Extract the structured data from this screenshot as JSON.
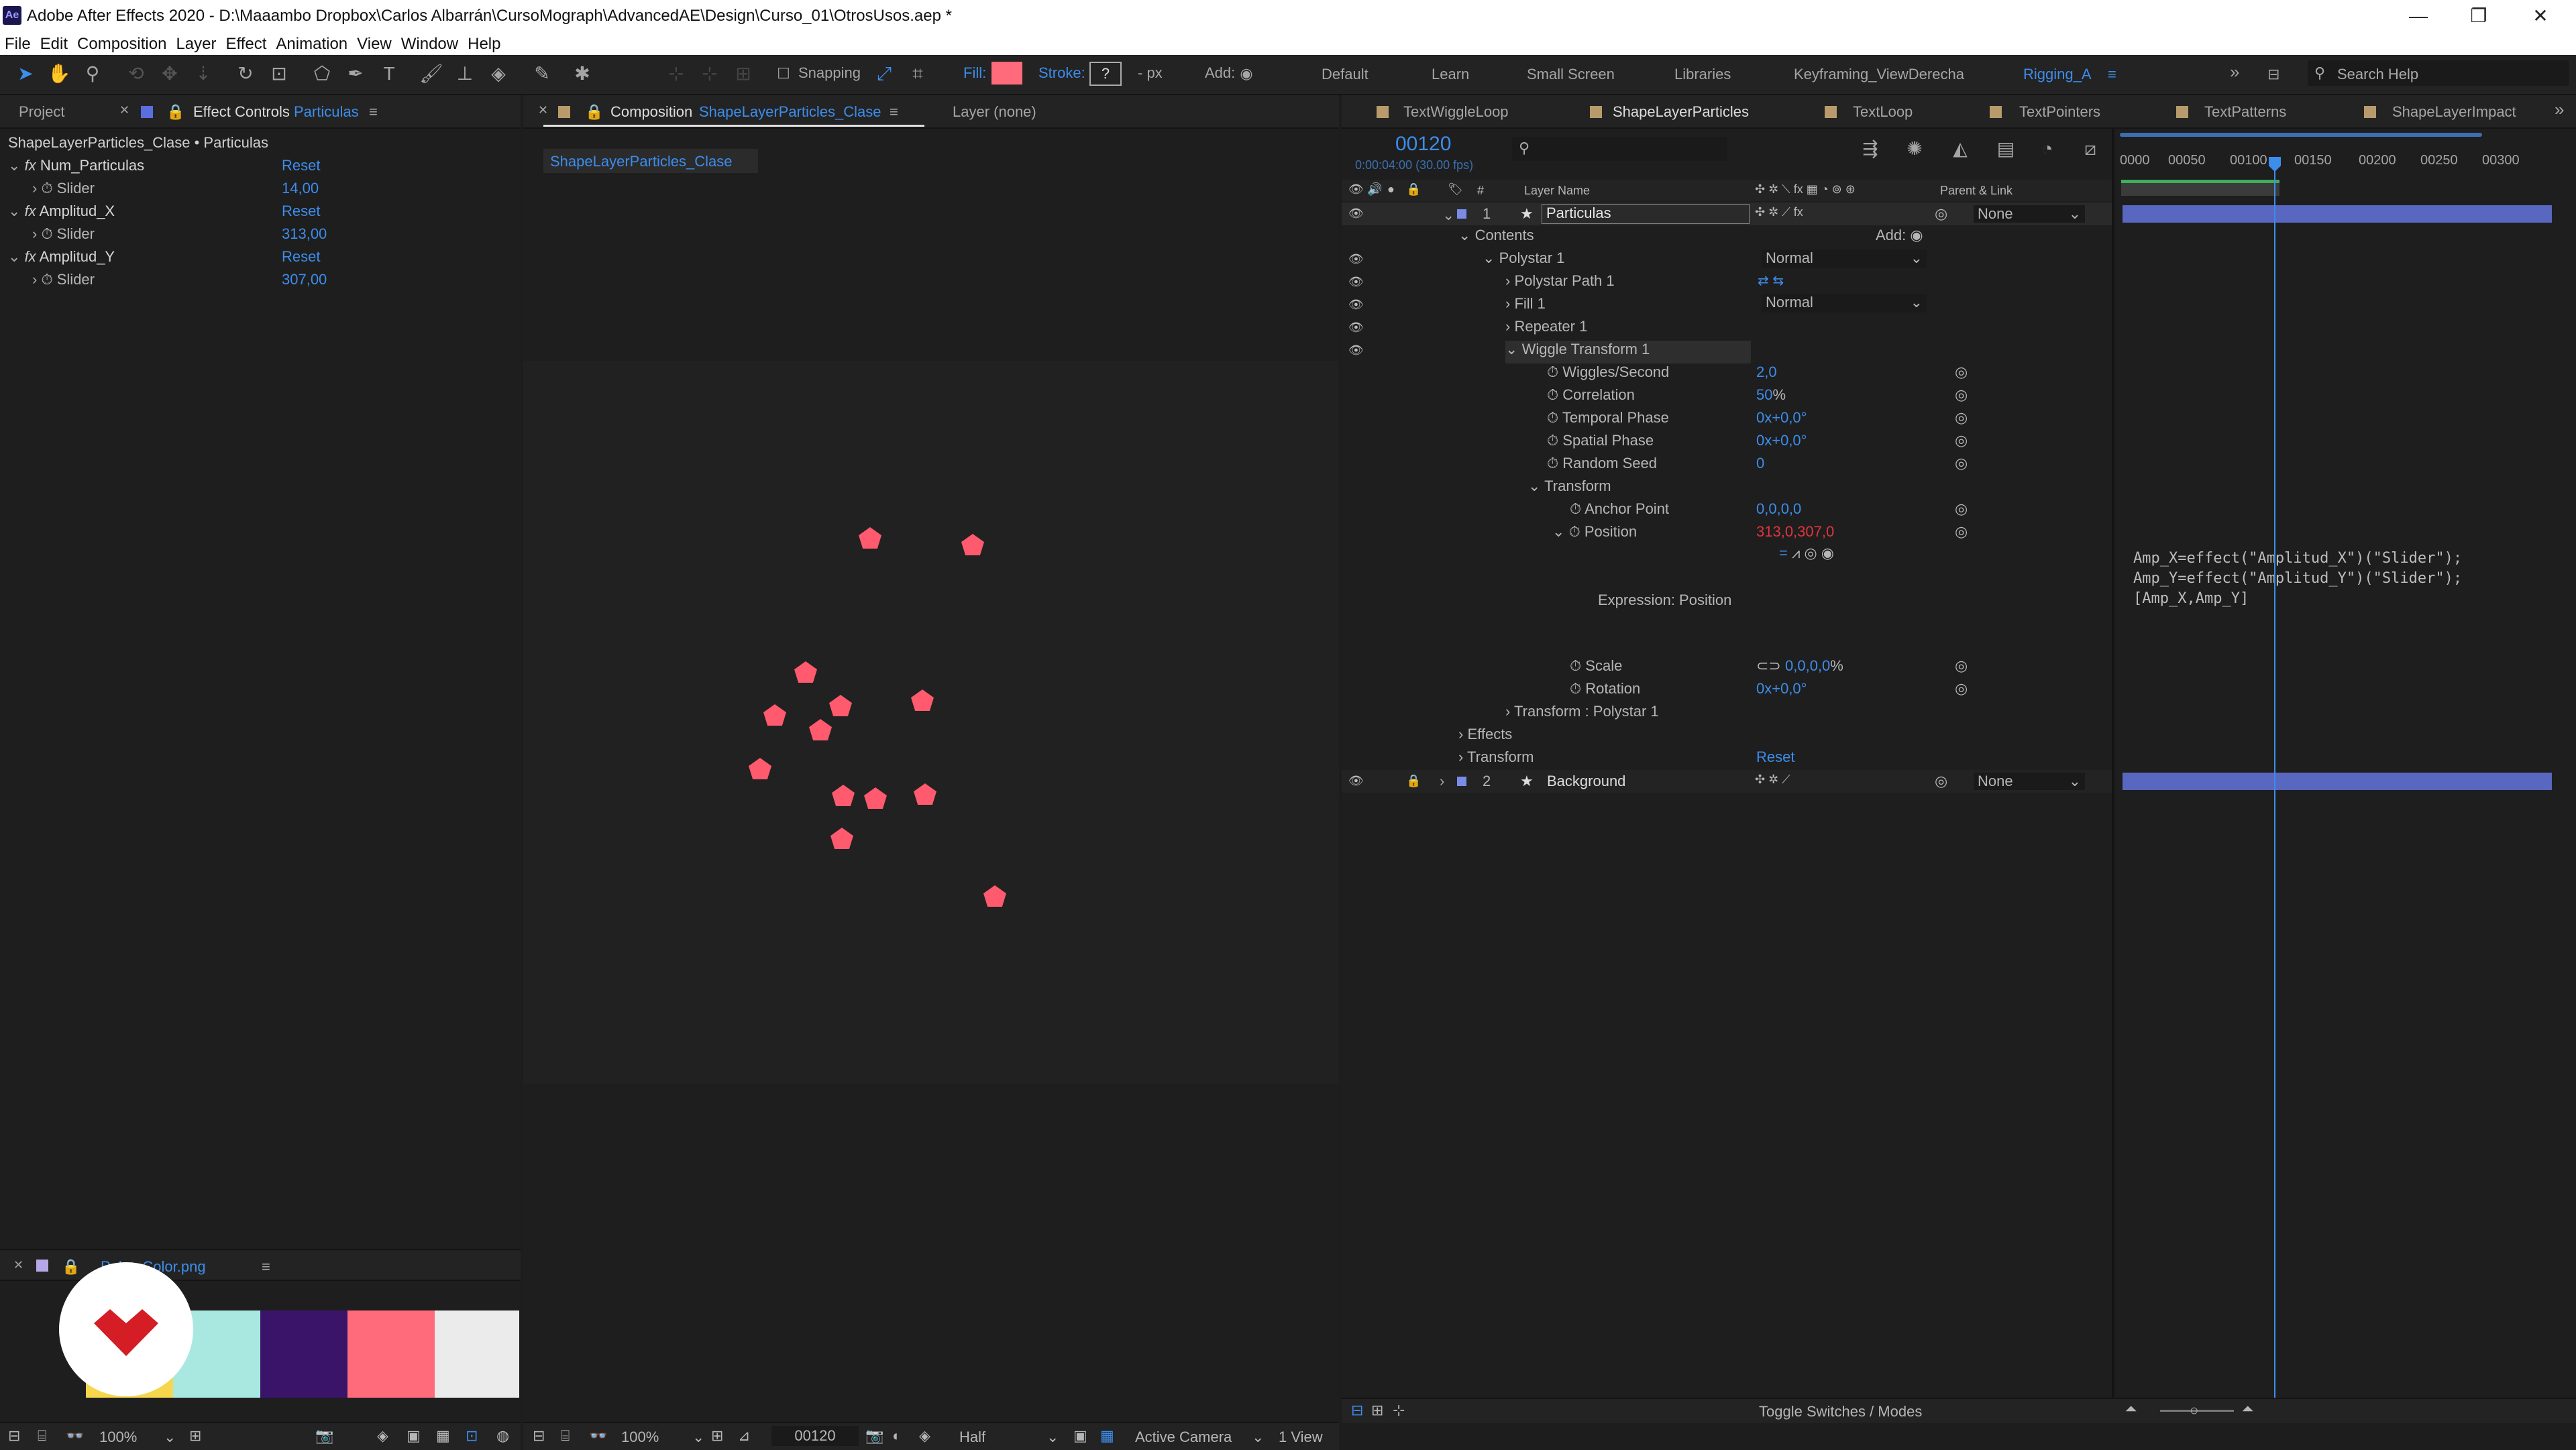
{
  "window": {
    "title": "Adobe After Effects 2020 - D:\\Maaambo Dropbox\\Carlos Albarrán\\CursoMograph\\AdvancedAE\\Design\\Curso_01\\OtrosUsos.aep *",
    "app_icon": "Ae"
  },
  "menu": [
    "File",
    "Edit",
    "Composition",
    "Layer",
    "Effect",
    "Animation",
    "View",
    "Window",
    "Help"
  ],
  "toolbar": {
    "snapping": "Snapping",
    "fill_label": "Fill:",
    "stroke_label": "Stroke:",
    "stroke_value": "?",
    "stroke_unit": "- px",
    "add_label": "Add:",
    "fill_color": "#ff6b7a",
    "workspaces": [
      "Default",
      "Learn",
      "Small Screen",
      "Libraries",
      "Keyframing_ViewDerecha",
      "Rigging_A"
    ],
    "active_workspace": "Rigging_A",
    "search_placeholder": "Search Help"
  },
  "left_panel": {
    "tab_project": "Project",
    "tab_effect": "Effect Controls",
    "tab_effect_layer": "Particulas",
    "header": "ShapeLayerParticles_Clase • Particulas",
    "effects": [
      {
        "name": "Num_Particulas",
        "reset": "Reset",
        "prop": "Slider",
        "value": "14,00"
      },
      {
        "name": "Amplitud_X",
        "reset": "Reset",
        "prop": "Slider",
        "value": "313,00"
      },
      {
        "name": "Amplitud_Y",
        "reset": "Reset",
        "prop": "Slider",
        "value": "307,00"
      }
    ]
  },
  "footage_panel": {
    "title": "PaletaColor.png",
    "swatches": [
      "#f5d64d",
      "#a9e8e0",
      "#3a1469",
      "#ff6b7a",
      "#ebebeb"
    ]
  },
  "comp_panel": {
    "tab_label": "Composition",
    "comp_name": "ShapeLayerParticles_Clase",
    "layer_tab": "Layer  (none)",
    "sub_tab": "ShapeLayerParticles_Clase",
    "zoom": "100%",
    "timecode": "00120",
    "resolution": "Half",
    "camera": "Active Camera",
    "view": "1 View"
  },
  "left_footer": {
    "zoom": "100%"
  },
  "timeline": {
    "tabs": [
      "TextWiggleLoop",
      "ShapeLayerParticles",
      "TextLoop",
      "TextPointers",
      "TextPatterns",
      "ShapeLayerImpact"
    ],
    "timecode": "00120",
    "timecode_sub": "0:00:04:00 (30.00 fps)",
    "col_layer_name": "Layer Name",
    "col_parent": "Parent & Link",
    "ruler": [
      "0000",
      "00050",
      "00100",
      "00150",
      "00200",
      "00250",
      "00300"
    ],
    "layer1": {
      "num": "1",
      "name": "Particulas",
      "parent": "None"
    },
    "layer2": {
      "num": "2",
      "name": "Background",
      "parent": "None"
    },
    "contents": "Contents",
    "add": "Add:",
    "polystar": "Polystar 1",
    "polystar_mode": "Normal",
    "polystar_path": "Polystar Path 1",
    "fill": "Fill 1",
    "fill_mode": "Normal",
    "repeater": "Repeater 1",
    "wiggle": "Wiggle Transform 1",
    "wiggles_label": "Wiggles/Second",
    "wiggles_value": "2,0",
    "correlation_label": "Correlation",
    "correlation_value": "50",
    "correlation_unit": "%",
    "temporal_label": "Temporal Phase",
    "temporal_value": "0x+0,0°",
    "spatial_label": "Spatial Phase",
    "spatial_value": "0x+0,0°",
    "seed_label": "Random Seed",
    "seed_value": "0",
    "transform": "Transform",
    "anchor_label": "Anchor Point",
    "anchor_value": "0,0,0,0",
    "position_label": "Position",
    "position_value": "313,0,307,0",
    "expression_label": "Expression: Position",
    "scale_label": "Scale",
    "scale_value": "0,0,0,0",
    "scale_unit": "%",
    "rotation_label": "Rotation",
    "rotation_value": "0x+0,0°",
    "transform_polystar": "Transform : Polystar 1",
    "effects": "Effects",
    "layer_transform": "Transform",
    "layer_transform_reset": "Reset",
    "expression_lines": [
      "Amp_X=effect(\"Amplitud_X\")(\"Slider\");",
      "Amp_Y=effect(\"Amplitud_Y\")(\"Slider\");",
      "[Amp_X,Amp_Y]"
    ],
    "toggle": "Toggle Switches / Modes"
  }
}
